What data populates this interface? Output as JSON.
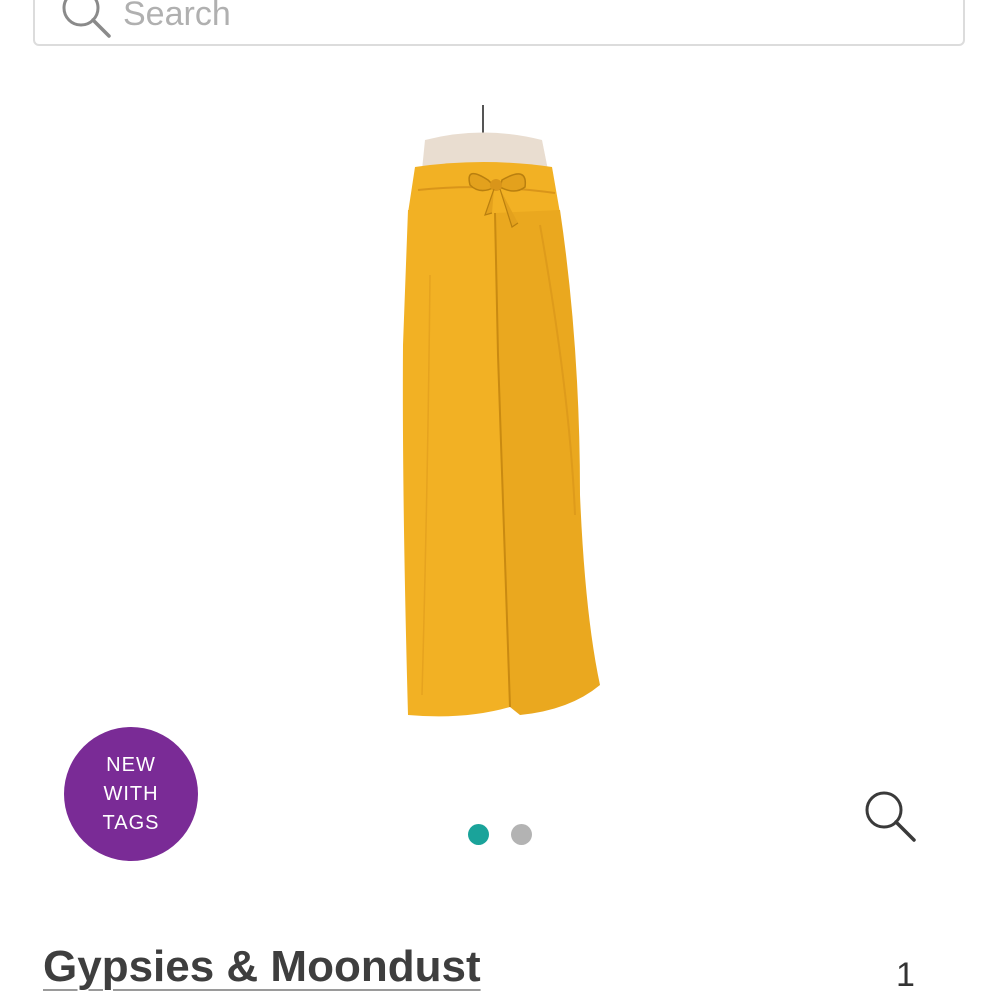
{
  "search": {
    "placeholder": "Search",
    "icon": "search-icon"
  },
  "product": {
    "image_icon": "yellow-wide-leg-pants-image",
    "colors": {
      "pants": "#f2b124",
      "pants_shadow": "#d9951a",
      "mannequin": "#e9ddd0"
    }
  },
  "badge": {
    "line1": "NEW",
    "line2": "WITH",
    "line3": "TAGS",
    "color": "#7a2b96"
  },
  "carousel": {
    "active_index": 0,
    "count": 2,
    "active_color": "#1aa39a",
    "inactive_color": "#b3b3b3"
  },
  "zoom": {
    "icon": "zoom-icon"
  },
  "listing": {
    "brand": "Gypsies & Moondust",
    "quantity": "1"
  }
}
